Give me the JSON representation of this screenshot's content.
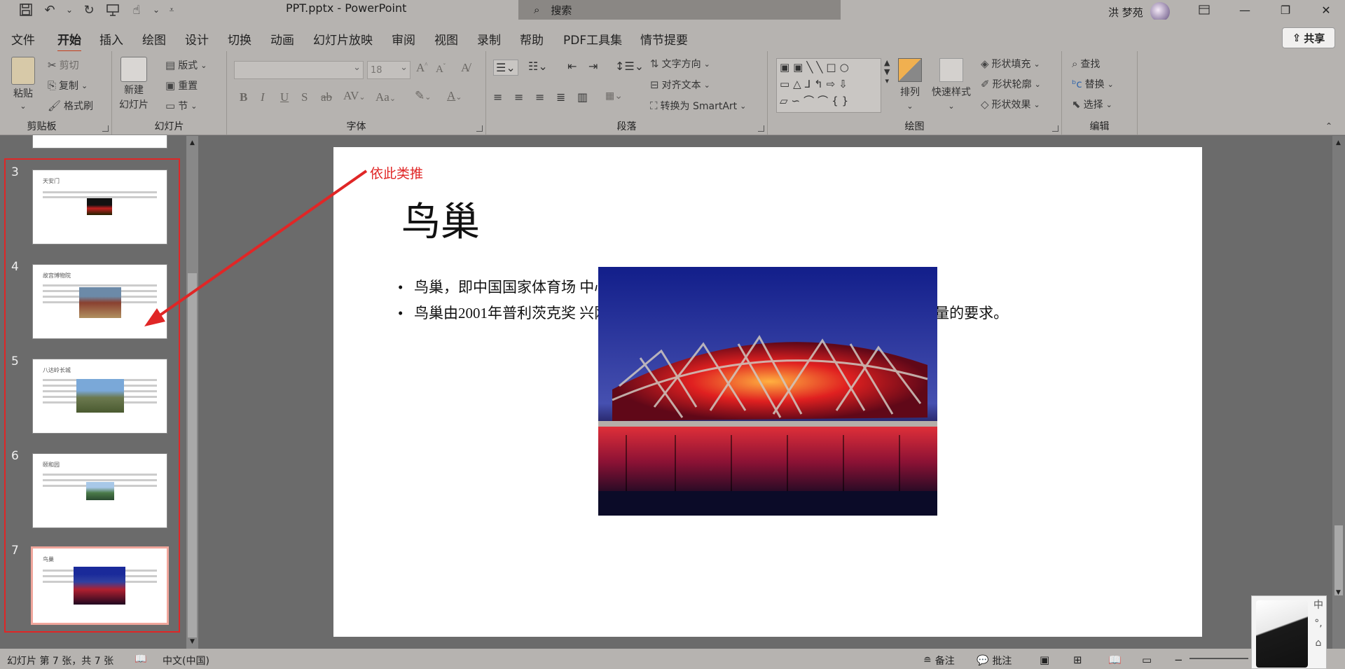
{
  "app": {
    "window_title": "PPT.pptx  -  PowerPoint",
    "search_placeholder": "搜索",
    "user_name": "洪 梦苑",
    "share_label": "共享"
  },
  "tabs": [
    "文件",
    "开始",
    "插入",
    "绘图",
    "设计",
    "切换",
    "动画",
    "幻灯片放映",
    "审阅",
    "视图",
    "录制",
    "帮助",
    "PDF工具集",
    "情节提要"
  ],
  "active_tab": "开始",
  "ribbon": {
    "clipboard": {
      "label": "剪贴板",
      "paste": "粘贴",
      "cut": "剪切",
      "copy": "复制",
      "format_painter": "格式刷"
    },
    "slides": {
      "label": "幻灯片",
      "new_slide_line1": "新建",
      "new_slide_line2": "幻灯片",
      "layout": "版式",
      "reset": "重置",
      "section": "节"
    },
    "font": {
      "label": "字体",
      "font_name": "",
      "font_size": "18"
    },
    "paragraph": {
      "label": "段落",
      "text_direction": "文字方向",
      "align_text": "对齐文本",
      "convert_smartart": "转换为 SmartArt"
    },
    "drawing": {
      "label": "绘图",
      "arrange": "排列",
      "quick_styles": "快速样式",
      "shape_fill": "形状填充",
      "shape_outline": "形状轮廓",
      "shape_effects": "形状效果"
    },
    "editing": {
      "label": "编辑",
      "find": "查找",
      "replace": "替换",
      "select": "选择"
    }
  },
  "thumbnails": [
    {
      "num": "3",
      "title": "天安门"
    },
    {
      "num": "4",
      "title": "故宫博物院"
    },
    {
      "num": "5",
      "title": "八达岭长城"
    },
    {
      "num": "6",
      "title": "颐和园"
    },
    {
      "num": "7",
      "title": "鸟巢"
    }
  ],
  "selected_slide": "7",
  "annotation": "依此类推",
  "slide": {
    "title": "鸟巢",
    "bullets": [
      "鸟巢，即中国国家体育场                                                                                中心区南部，为2008年第29届奥林匹克运动会的主体",
      "鸟巢由2001年普利茨克奖                                                                                兴刚等合作设计。整体采用“曲线箱形结构”，建筑                                                                                观众量的要求。"
    ]
  },
  "status": {
    "slide_info": "幻灯片 第 7 张，共 7 张",
    "language": "中文(中国)",
    "notes": "备注",
    "comments": "批注"
  },
  "ime": {
    "mode": "中",
    "punct": "°,",
    "shirt": "⌂"
  },
  "colors": {
    "accent": "#c43e1c",
    "annotation": "#e02626",
    "chrome": "#b6b3b0"
  }
}
